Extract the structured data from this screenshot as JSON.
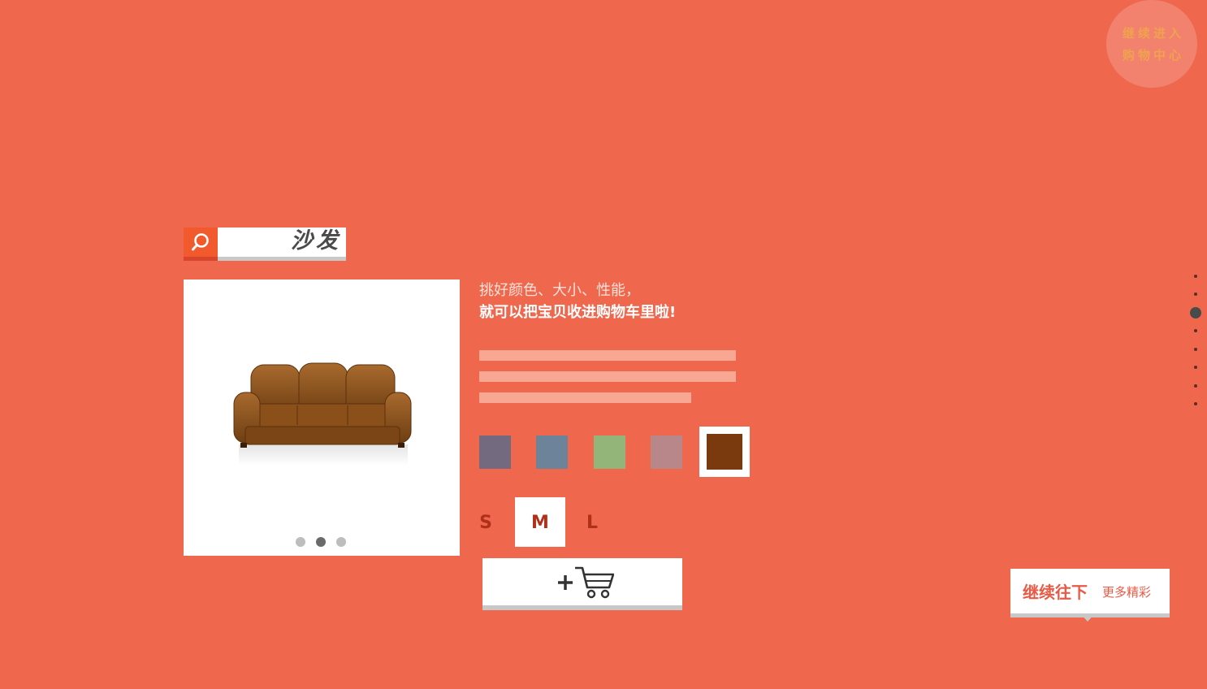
{
  "badge": {
    "line1": "继续进入",
    "line2": "购物中心"
  },
  "search": {
    "query": "沙发"
  },
  "product": {
    "name": "sofa",
    "image_icon": "sofa-image",
    "carousel": {
      "count": 3,
      "active_index": 1
    }
  },
  "description": {
    "line1": "挑好颜色、大小、性能，",
    "line2": "就可以把宝贝收进购物车里啦!"
  },
  "colors": [
    {
      "hex": "#746a80",
      "selected": false
    },
    {
      "hex": "#6c839a",
      "selected": false
    },
    {
      "hex": "#93b57a",
      "selected": false
    },
    {
      "hex": "#b8878a",
      "selected": false
    },
    {
      "hex": "#7a3a0e",
      "selected": true
    }
  ],
  "sizes": [
    {
      "label": "S",
      "selected": false
    },
    {
      "label": "M",
      "selected": true
    },
    {
      "label": "L",
      "selected": false
    }
  ],
  "cart_button": {
    "icon": "add-to-cart-icon"
  },
  "side_nav": {
    "count": 8,
    "active_index": 2
  },
  "continue": {
    "main": "继续往下",
    "sub": "更多精彩"
  },
  "theme": {
    "background": "#ef674d",
    "accent": "#f25a2e"
  }
}
